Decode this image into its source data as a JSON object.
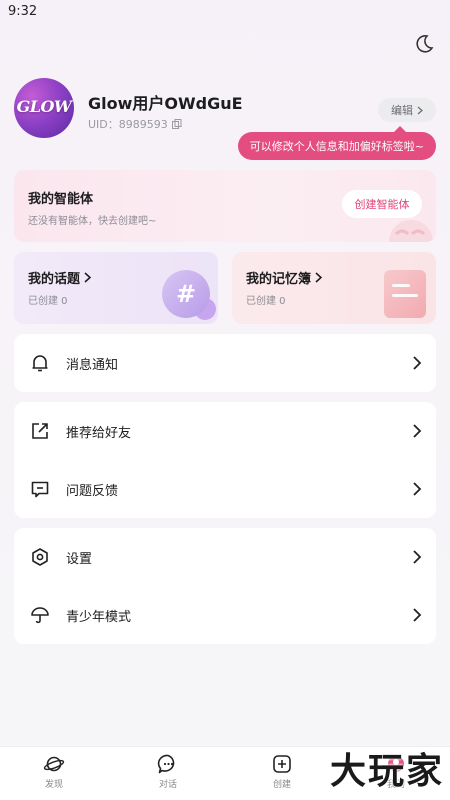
{
  "status_bar": {
    "time": "9:32"
  },
  "profile": {
    "avatar_text": "GLOW",
    "username": "Glow用户OWdGuE",
    "uid": "UID：8989593",
    "edit_label": "编辑",
    "tooltip": "可以修改个人信息和加偏好标签啦~"
  },
  "agent": {
    "title": "我的智能体",
    "subtitle": "还没有智能体，快去创建吧~",
    "create_label": "创建智能体"
  },
  "topics": {
    "title": "我的话题",
    "count": "已创建 0"
  },
  "memo": {
    "title": "我的记忆簿",
    "count": "已创建 0"
  },
  "menu": {
    "notifications": "消息通知",
    "recommend": "推荐给好友",
    "feedback": "问题反馈",
    "settings": "设置",
    "youth_mode": "青少年模式"
  },
  "nav": {
    "discover": "发现",
    "chat": "对话",
    "create": "创建",
    "mine": "我的"
  },
  "watermark": "大玩家",
  "colors": {
    "accent": "#e44d80",
    "avatar": "#8a3fc4"
  }
}
